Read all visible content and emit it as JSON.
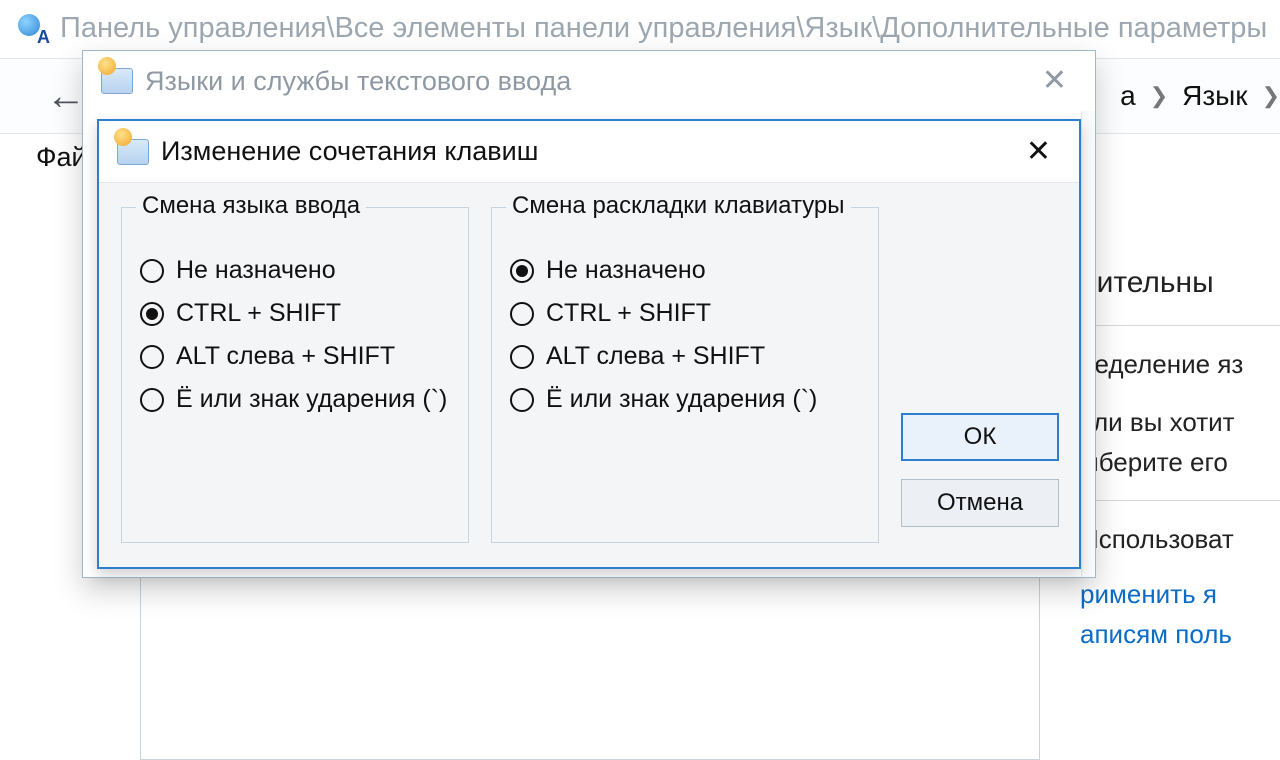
{
  "bg": {
    "title": "Панель управления\\Все элементы панели управления\\Язык\\Дополнительные параметры",
    "breadcrumb_item_a": "а",
    "breadcrumb_item_lang": "Язык",
    "menu_file": "Фай",
    "right_fragments": {
      "l1": "нительны",
      "l2": "ределение яз",
      "l3": "сли вы хотит",
      "l4": "ыберите его",
      "l5": "Использоват",
      "l6": "рименить я",
      "l7": "аписям поль"
    }
  },
  "outer_dialog": {
    "title": "Языки и службы текстового ввода"
  },
  "inner_dialog": {
    "title": "Изменение сочетания клавиш",
    "group1": {
      "legend": "Смена языка ввода",
      "options": [
        "Не назначено",
        "CTRL + SHIFT",
        "ALT слева + SHIFT",
        "Ё или знак ударения (`)"
      ],
      "selected_index": 1
    },
    "group2": {
      "legend": "Смена раскладки клавиатуры",
      "options": [
        "Не назначено",
        "CTRL + SHIFT",
        "ALT слева + SHIFT",
        "Ё или знак ударения (`)"
      ],
      "selected_index": 0
    },
    "ok_label": "ОК",
    "cancel_label": "Отмена"
  }
}
